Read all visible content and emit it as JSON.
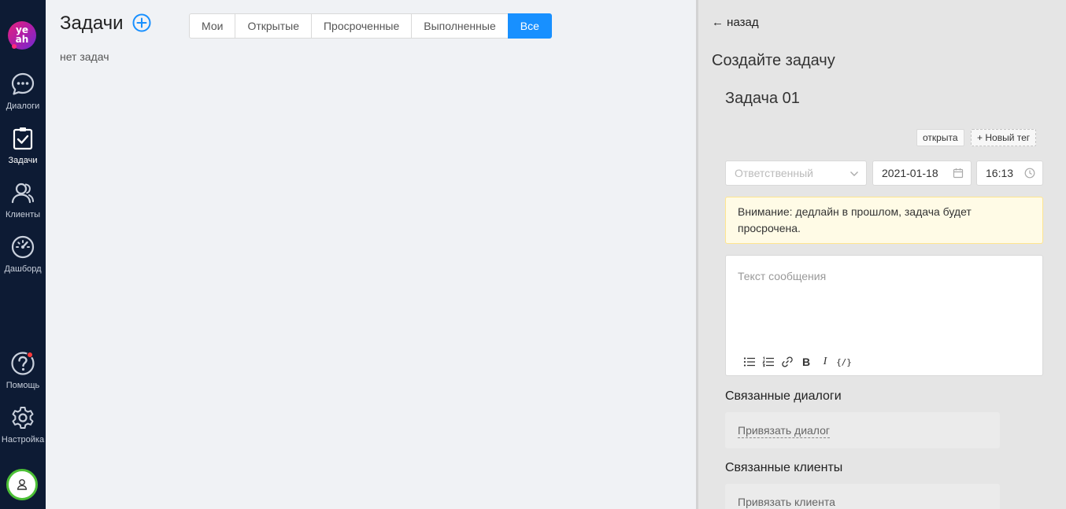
{
  "logo": {
    "text": "ye ah"
  },
  "sidebar": {
    "items": [
      {
        "label": "Диалоги",
        "icon": "chat-bubble-icon"
      },
      {
        "label": "Задачи",
        "icon": "clipboard-check-icon"
      },
      {
        "label": "Клиенты",
        "icon": "users-icon"
      },
      {
        "label": "Дашборд",
        "icon": "speedometer-icon"
      },
      {
        "label": "Помощь",
        "icon": "help-circle-icon"
      },
      {
        "label": "Настройка",
        "icon": "gear-icon"
      }
    ]
  },
  "main": {
    "title": "Задачи",
    "filters": [
      "Мои",
      "Открытые",
      "Просроченные",
      "Выполненные",
      "Все"
    ],
    "active_filter": "Все",
    "empty_text": "нет задач"
  },
  "panel": {
    "back": "← назад",
    "title": "Создайте задачу",
    "task_name": "Задача 01",
    "status_tag": "открыта",
    "new_tag": "Новый тег",
    "responsible_placeholder": "Ответственный",
    "date": "2021-01-18",
    "time": "16:13",
    "warning": "Внимание: дедлайн в прошлом, задача будет просрочена.",
    "message_placeholder": "Текст сообщения",
    "linked_dialogs_title": "Связанные диалоги",
    "link_dialog": "Привязать диалог",
    "linked_clients_title": "Связанные клиенты",
    "link_client": "Привязать клиента"
  },
  "colors": {
    "sidebar_bg": "#0d1b34",
    "accent": "#1890ff",
    "avatar_ring": "#4cc036",
    "warning_bg": "#fffbe6",
    "notification_badge": "#ff3b3b"
  }
}
